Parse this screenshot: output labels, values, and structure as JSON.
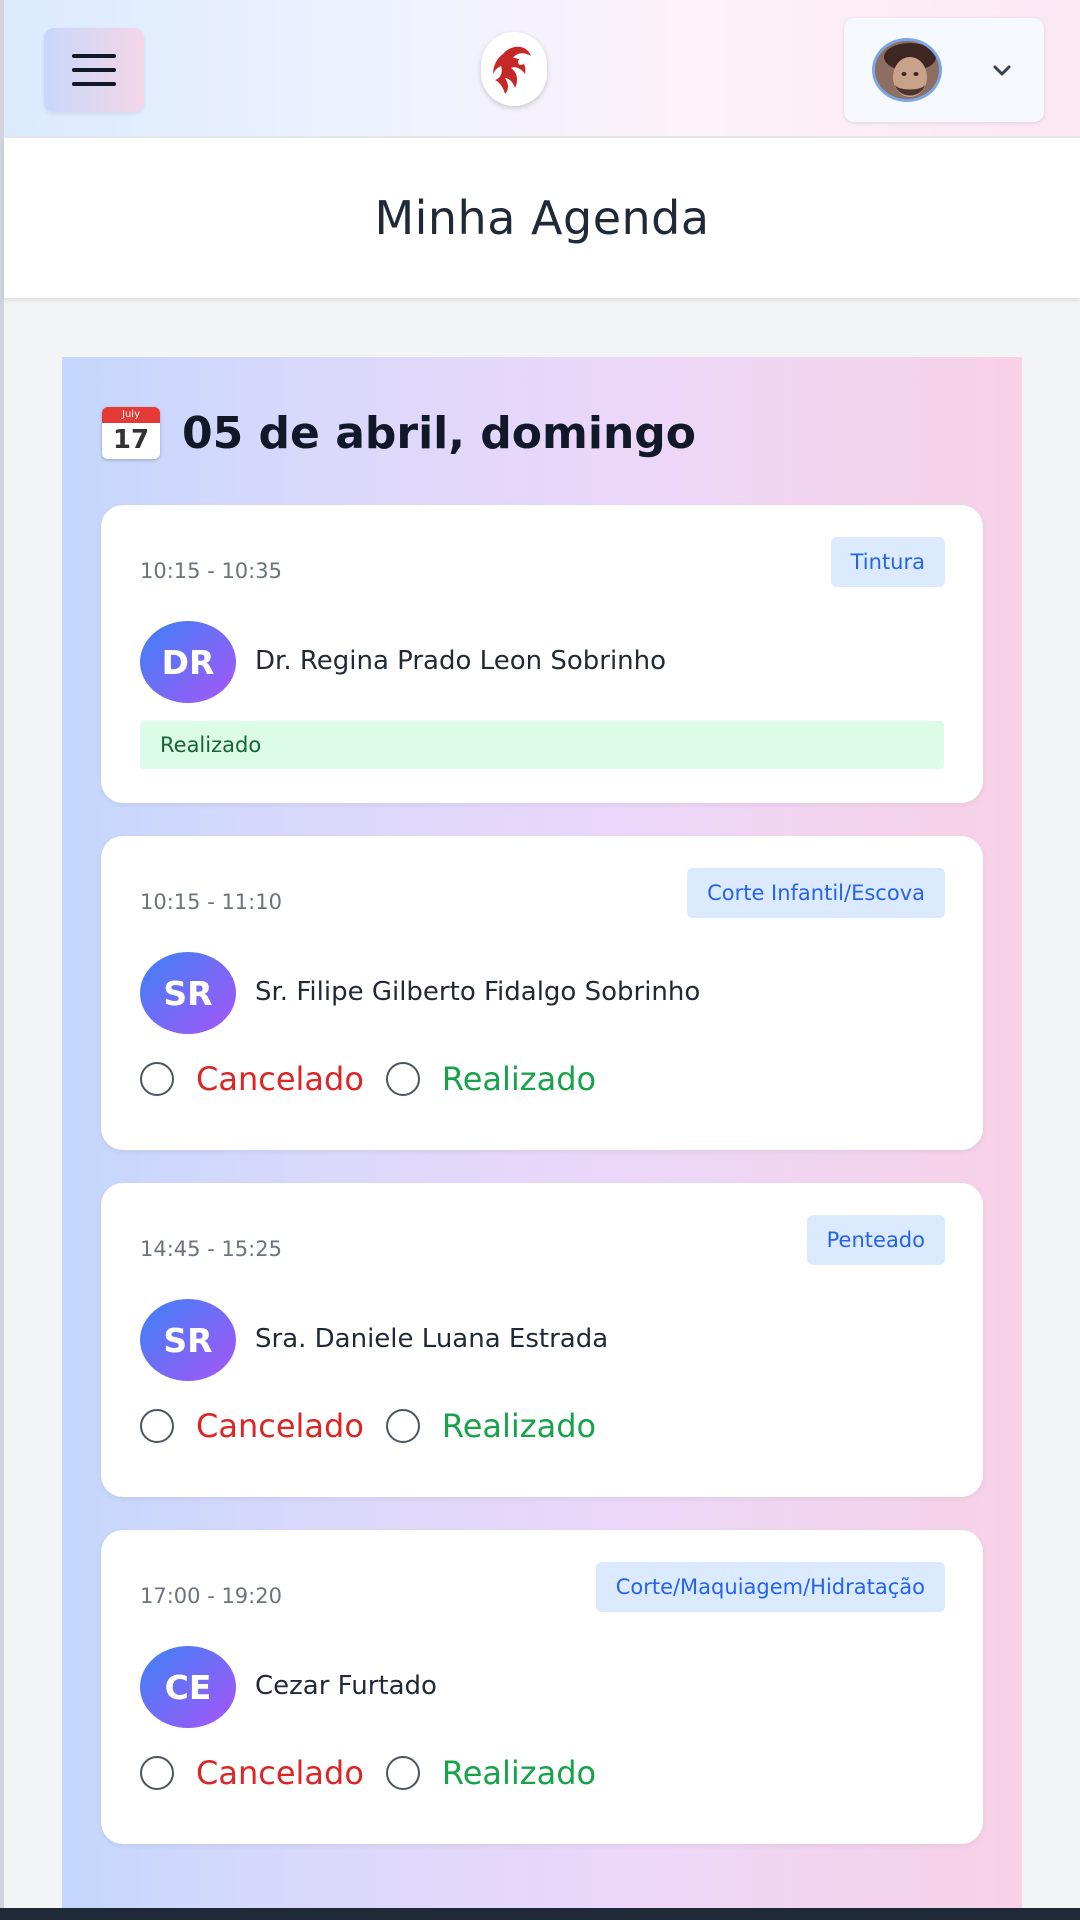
{
  "header": {
    "menu_icon": "hamburger-menu-icon",
    "logo_icon": "salon-logo-icon",
    "user_avatar": "user-avatar-photo",
    "dropdown_icon": "chevron-down-icon"
  },
  "page": {
    "title": "Minha Agenda"
  },
  "day": {
    "icon": "calendar-icon",
    "calendar_month": "July",
    "calendar_day": "17",
    "title": "05 de abril, domingo"
  },
  "appointments": [
    {
      "time": "10:15 - 10:35",
      "service": "Tintura",
      "initials": "DR",
      "client": "Dr. Regina Prado Leon Sobrinho",
      "status": "Realizado"
    },
    {
      "time": "10:15 - 11:10",
      "service": "Corte Infantil/Escova",
      "initials": "SR",
      "client": "Sr. Filipe Gilberto Fidalgo Sobrinho",
      "cancel_label": "Cancelado",
      "done_label": "Realizado"
    },
    {
      "time": "14:45 - 15:25",
      "service": "Penteado",
      "initials": "SR",
      "client": "Sra. Daniele Luana Estrada",
      "cancel_label": "Cancelado",
      "done_label": "Realizado"
    },
    {
      "time": "17:00 - 19:20",
      "service": "Corte/Maquiagem/Hidratação",
      "initials": "CE",
      "client": "Cezar Furtado",
      "cancel_label": "Cancelado",
      "done_label": "Realizado"
    }
  ],
  "colors": {
    "accent_blue": "#2563eb",
    "cancel_red": "#dc2626",
    "done_green": "#16a34a",
    "done_bg": "#dcfce7"
  }
}
